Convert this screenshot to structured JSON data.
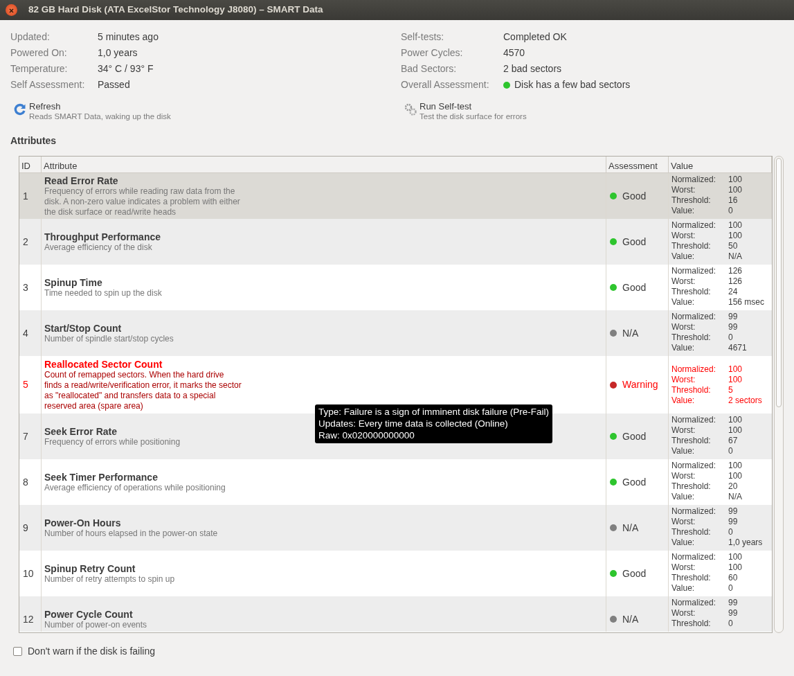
{
  "window": {
    "title": "82 GB Hard Disk (ATA ExcelStor Technology J8080) – SMART Data"
  },
  "info_left": [
    {
      "label": "Updated:",
      "value": "5 minutes ago"
    },
    {
      "label": "Powered On:",
      "value": "1,0 years"
    },
    {
      "label": "Temperature:",
      "value": "34° C / 93° F"
    },
    {
      "label": "Self Assessment:",
      "value": "Passed"
    }
  ],
  "info_right": [
    {
      "label": "Self-tests:",
      "value": "Completed OK"
    },
    {
      "label": "Power Cycles:",
      "value": "4570"
    },
    {
      "label": "Bad Sectors:",
      "value": "2 bad sectors"
    },
    {
      "label": "Overall Assessment:",
      "value": "Disk has a few bad sectors",
      "color": "#2ec52e"
    }
  ],
  "actions": [
    {
      "kind": "refresh",
      "title": "Refresh",
      "subtitle": "Reads SMART Data, waking up the disk"
    },
    {
      "kind": "selftest",
      "title": "Run Self-test",
      "subtitle": "Test the disk surface for errors"
    }
  ],
  "section_title": "Attributes",
  "table": {
    "columns": [
      "ID",
      "Attribute",
      "Assessment",
      "Value"
    ],
    "rows": [
      {
        "id": "1",
        "name": "Read Error Rate",
        "description": "Frequency of errors while reading raw data from the disk. A non-zero value indicates a problem with either the disk surface or read/write heads",
        "assessment": "Good",
        "color": "#2ec52e",
        "warning": false,
        "selected": true,
        "values": [
          [
            "Normalized:",
            "100"
          ],
          [
            "Worst:",
            "100"
          ],
          [
            "Threshold:",
            "16"
          ],
          [
            "Value:",
            "0"
          ]
        ]
      },
      {
        "id": "2",
        "name": "Throughput Performance",
        "description": "Average efficiency of the disk",
        "assessment": "Good",
        "color": "#2ec52e",
        "warning": false,
        "selected": false,
        "values": [
          [
            "Normalized:",
            "100"
          ],
          [
            "Worst:",
            "100"
          ],
          [
            "Threshold:",
            "50"
          ],
          [
            "Value:",
            "N/A"
          ]
        ]
      },
      {
        "id": "3",
        "name": "Spinup Time",
        "description": "Time needed to spin up the disk",
        "assessment": "Good",
        "color": "#2ec52e",
        "warning": false,
        "selected": false,
        "values": [
          [
            "Normalized:",
            "126"
          ],
          [
            "Worst:",
            "126"
          ],
          [
            "Threshold:",
            "24"
          ],
          [
            "Value:",
            "156 msec"
          ]
        ]
      },
      {
        "id": "4",
        "name": "Start/Stop Count",
        "description": "Number of spindle start/stop cycles",
        "assessment": "N/A",
        "color": "#808080",
        "warning": false,
        "selected": false,
        "values": [
          [
            "Normalized:",
            "99"
          ],
          [
            "Worst:",
            "99"
          ],
          [
            "Threshold:",
            "0"
          ],
          [
            "Value:",
            "4671"
          ]
        ]
      },
      {
        "id": "5",
        "name": "Reallocated Sector Count",
        "description": "Count of remapped sectors. When the hard drive finds a read/write/verification error, it marks the sector as \"reallocated\" and transfers data to a special reserved area (spare area)",
        "assessment": "Warning",
        "color": "#c62828",
        "warning": true,
        "selected": false,
        "values": [
          [
            "Normalized:",
            "100"
          ],
          [
            "Worst:",
            "100"
          ],
          [
            "Threshold:",
            "5"
          ],
          [
            "Value:",
            "2 sectors"
          ]
        ]
      },
      {
        "id": "7",
        "name": "Seek Error Rate",
        "description": "Frequency of errors while positioning",
        "assessment": "Good",
        "color": "#2ec52e",
        "warning": false,
        "selected": false,
        "values": [
          [
            "Normalized:",
            "100"
          ],
          [
            "Worst:",
            "100"
          ],
          [
            "Threshold:",
            "67"
          ],
          [
            "Value:",
            "0"
          ]
        ]
      },
      {
        "id": "8",
        "name": "Seek Timer Performance",
        "description": "Average efficiency of operations while positioning",
        "assessment": "Good",
        "color": "#2ec52e",
        "warning": false,
        "selected": false,
        "values": [
          [
            "Normalized:",
            "100"
          ],
          [
            "Worst:",
            "100"
          ],
          [
            "Threshold:",
            "20"
          ],
          [
            "Value:",
            "N/A"
          ]
        ]
      },
      {
        "id": "9",
        "name": "Power-On Hours",
        "description": "Number of hours elapsed in the power-on state",
        "assessment": "N/A",
        "color": "#808080",
        "warning": false,
        "selected": false,
        "values": [
          [
            "Normalized:",
            "99"
          ],
          [
            "Worst:",
            "99"
          ],
          [
            "Threshold:",
            "0"
          ],
          [
            "Value:",
            "1,0 years"
          ]
        ]
      },
      {
        "id": "10",
        "name": "Spinup Retry Count",
        "description": "Number of retry attempts to spin up",
        "assessment": "Good",
        "color": "#2ec52e",
        "warning": false,
        "selected": false,
        "values": [
          [
            "Normalized:",
            "100"
          ],
          [
            "Worst:",
            "100"
          ],
          [
            "Threshold:",
            "60"
          ],
          [
            "Value:",
            "0"
          ]
        ]
      },
      {
        "id": "12",
        "name": "Power Cycle Count",
        "description": "Number of power-on events",
        "assessment": "N/A",
        "color": "#808080",
        "warning": false,
        "selected": false,
        "values": [
          [
            "Normalized:",
            "99"
          ],
          [
            "Worst:",
            "99"
          ],
          [
            "Threshold:",
            "0"
          ]
        ]
      }
    ]
  },
  "tooltip": {
    "lines": [
      "Type: Failure is a sign of imminent disk failure (Pre-Fail)",
      "Updates: Every time data is collected (Online)",
      "Raw: 0x020000000000"
    ]
  },
  "checkbox": {
    "label": "Don't warn if the disk is failing",
    "checked": false
  }
}
